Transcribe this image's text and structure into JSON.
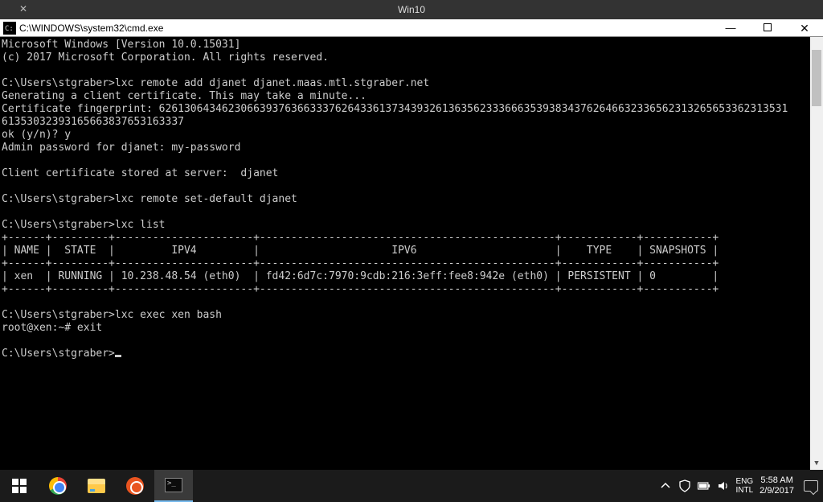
{
  "vm": {
    "title": "Win10"
  },
  "cmd_window": {
    "path": "C:\\WINDOWS\\system32\\cmd.exe"
  },
  "terminal": {
    "lines": [
      "Microsoft Windows [Version 10.0.15031]",
      "(c) 2017 Microsoft Corporation. All rights reserved.",
      "",
      "C:\\Users\\stgraber>lxc remote add djanet djanet.maas.mtl.stgraber.net",
      "Generating a client certificate. This may take a minute...",
      "Certificate fingerprint: 6261306434623066393763663337626433613734393261363562333666353938343762646632336562313265653362313531",
      "61353032393165663837653163337",
      "ok (y/n)? y",
      "Admin password for djanet: my-password",
      "",
      "Client certificate stored at server:  djanet",
      "",
      "C:\\Users\\stgraber>lxc remote set-default djanet",
      "",
      "C:\\Users\\stgraber>lxc list",
      "+------+---------+----------------------+-----------------------------------------------+------------+-----------+",
      "| NAME |  STATE  |         IPV4         |                     IPV6                      |    TYPE    | SNAPSHOTS |",
      "+------+---------+----------------------+-----------------------------------------------+------------+-----------+",
      "| xen  | RUNNING | 10.238.48.54 (eth0)  | fd42:6d7c:7970:9cdb:216:3eff:fee8:942e (eth0) | PERSISTENT | 0         |",
      "+------+---------+----------------------+-----------------------------------------------+------------+-----------+",
      "",
      "C:\\Users\\stgraber>lxc exec xen bash",
      "root@xen:~# exit",
      "",
      "C:\\Users\\stgraber>"
    ],
    "table": {
      "headers": [
        "NAME",
        "STATE",
        "IPV4",
        "IPV6",
        "TYPE",
        "SNAPSHOTS"
      ],
      "rows": [
        {
          "name": "xen",
          "state": "RUNNING",
          "ipv4": "10.238.48.54 (eth0)",
          "ipv6": "fd42:6d7c:7970:9cdb:216:3eff:fee8:942e (eth0)",
          "type": "PERSISTENT",
          "snapshots": "0"
        }
      ]
    },
    "prompt": "C:\\Users\\stgraber>"
  },
  "taskbar": {
    "items": [
      "start",
      "chrome",
      "file-explorer",
      "ubuntu",
      "cmd"
    ],
    "active": "cmd"
  },
  "tray": {
    "lang1": "ENG",
    "lang2": "INTL",
    "time": "5:58 AM",
    "date": "2/9/2017"
  }
}
